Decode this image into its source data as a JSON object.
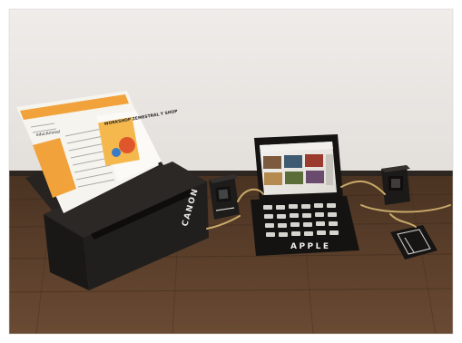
{
  "scene": {
    "printer_label": "CANON",
    "laptop_label": "APPLE",
    "flyer": {
      "headline": "WORKSHOP ZEMESTRAL Y SHOP",
      "brand": "educAnimal"
    }
  },
  "colors": {
    "wall": "#ece9e6",
    "floor": "#5b3f2c",
    "cardboard": "#1f1d1c",
    "flyer_orange": "#f2a23a",
    "cable": "#c8a96a"
  }
}
